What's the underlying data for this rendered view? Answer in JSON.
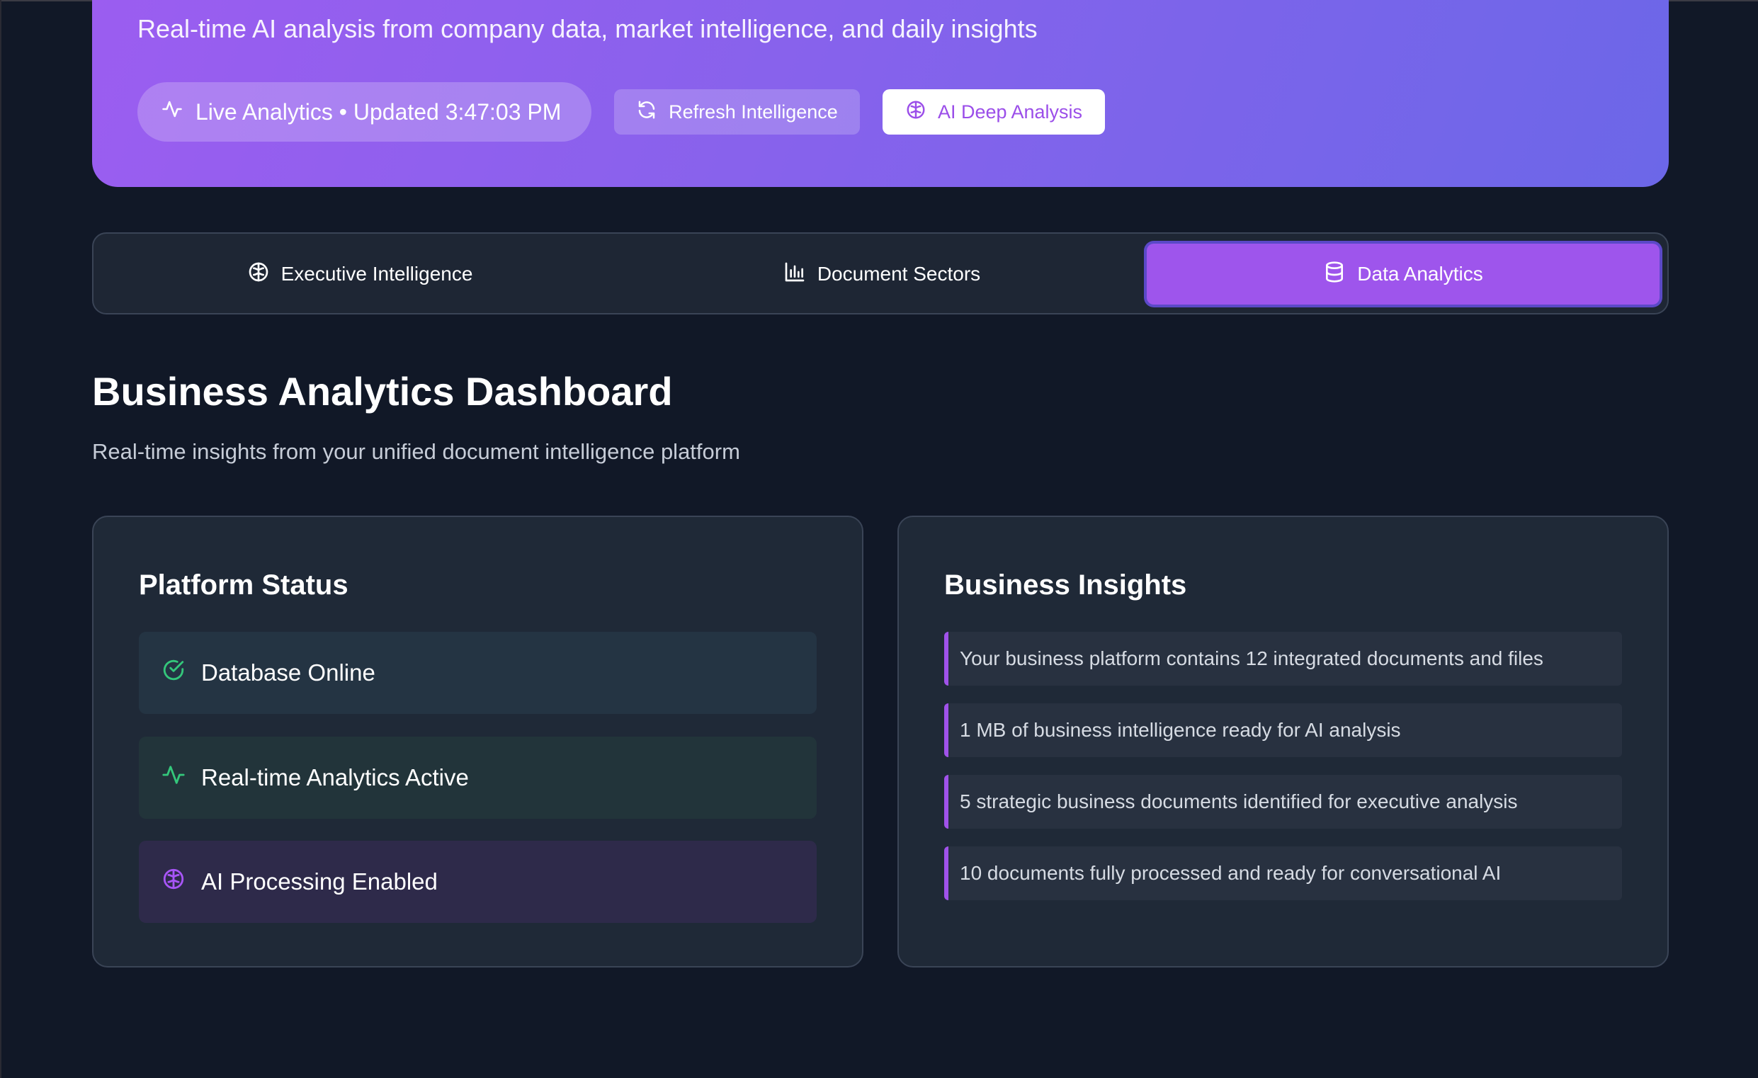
{
  "hero": {
    "subtitle": "Real-time AI analysis from company data, market intelligence, and daily insights",
    "live_label": "Live Analytics • Updated 3:47:03 PM",
    "refresh_label": "Refresh Intelligence",
    "ai_label": "AI Deep Analysis"
  },
  "tabs": [
    {
      "label": "Executive Intelligence",
      "icon": "brain-icon",
      "active": false
    },
    {
      "label": "Document Sectors",
      "icon": "bar-chart-icon",
      "active": false
    },
    {
      "label": "Data Analytics",
      "icon": "database-icon",
      "active": true
    }
  ],
  "dashboard": {
    "title": "Business Analytics Dashboard",
    "subtitle": "Real-time insights from your unified document intelligence platform"
  },
  "platform_status": {
    "title": "Platform Status",
    "items": [
      {
        "label": "Database Online",
        "icon": "check-circle-icon",
        "color": "#34c77b"
      },
      {
        "label": "Real-time Analytics Active",
        "icon": "activity-icon",
        "color": "#34c77b"
      },
      {
        "label": "AI Processing Enabled",
        "icon": "brain-icon",
        "color": "#a855f7"
      }
    ]
  },
  "business_insights": {
    "title": "Business Insights",
    "items": [
      "Your business platform contains 12 integrated documents and files",
      "1 MB of business intelligence ready for AI analysis",
      "5 strategic business documents identified for executive analysis",
      "10 documents fully processed and ready for conversational AI"
    ]
  },
  "colors": {
    "accent": "#9e55ec",
    "background": "#111827",
    "card": "#1f2937"
  }
}
